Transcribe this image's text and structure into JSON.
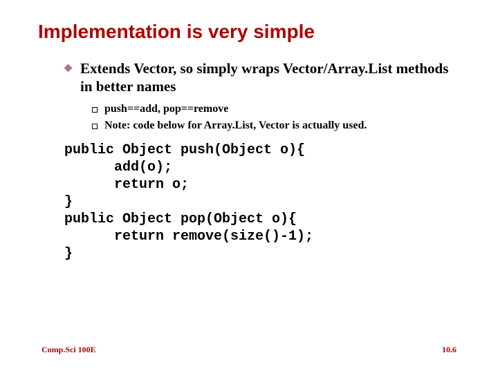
{
  "title": "Implementation is very simple",
  "bullet": "Extends Vector, so simply wraps Vector/Array.List methods in better names",
  "sub": {
    "a": "push==add, pop==remove",
    "b": "Note: code below for Array.List, Vector is actually used."
  },
  "code": "public Object push(Object o){\n      add(o);\n      return o;\n}\npublic Object pop(Object o){\n      return remove(size()-1);\n}",
  "footer": {
    "left": "Comp.Sci 100E",
    "right": "10.6"
  }
}
